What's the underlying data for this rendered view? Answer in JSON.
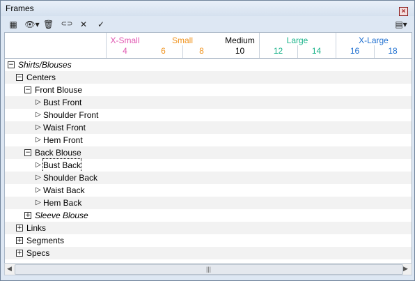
{
  "window": {
    "title": "Frames",
    "close_icon": "×"
  },
  "toolbar": {
    "table_icon": "▦",
    "view_icon": "👁▾",
    "delete_icon": "🗑",
    "link_icon": "⊂⊃",
    "cancel_icon": "✕",
    "accept_icon": "✓",
    "options_icon": "▤▾"
  },
  "sizes": {
    "xsmall": {
      "name": "X-Small",
      "nums": [
        "4"
      ],
      "color": "#e055b0"
    },
    "small": {
      "name": "Small",
      "nums": [
        "6",
        "8"
      ],
      "color": "#f0931e"
    },
    "medium": {
      "name": "Medium",
      "nums": [
        "10"
      ],
      "color": "#000000"
    },
    "large": {
      "name": "Large",
      "nums": [
        "12",
        "14"
      ],
      "color": "#19b38a"
    },
    "xlarge": {
      "name": "X-Large",
      "nums": [
        "16",
        "18"
      ],
      "color": "#1e6fd0"
    }
  },
  "tree": {
    "root": "Shirts/Blouses",
    "centers": "Centers",
    "front_blouse": "Front Blouse",
    "bust_front": "Bust Front",
    "shoulder_front": "Shoulder Front",
    "waist_front": "Waist Front",
    "hem_front": "Hem Front",
    "back_blouse": "Back Blouse",
    "bust_back": "Bust Back",
    "shoulder_back": "Shoulder Back",
    "waist_back": "Waist Back",
    "hem_back": "Hem Back",
    "sleeve_blouse": "Sleeve Blouse",
    "links": "Links",
    "segments": "Segments",
    "specs": "Specs"
  },
  "glyphs": {
    "minus": "−",
    "plus": "+",
    "triangle": "▷"
  },
  "scrollbar": {
    "left": "◀",
    "right": "▶",
    "grip": "|||"
  }
}
